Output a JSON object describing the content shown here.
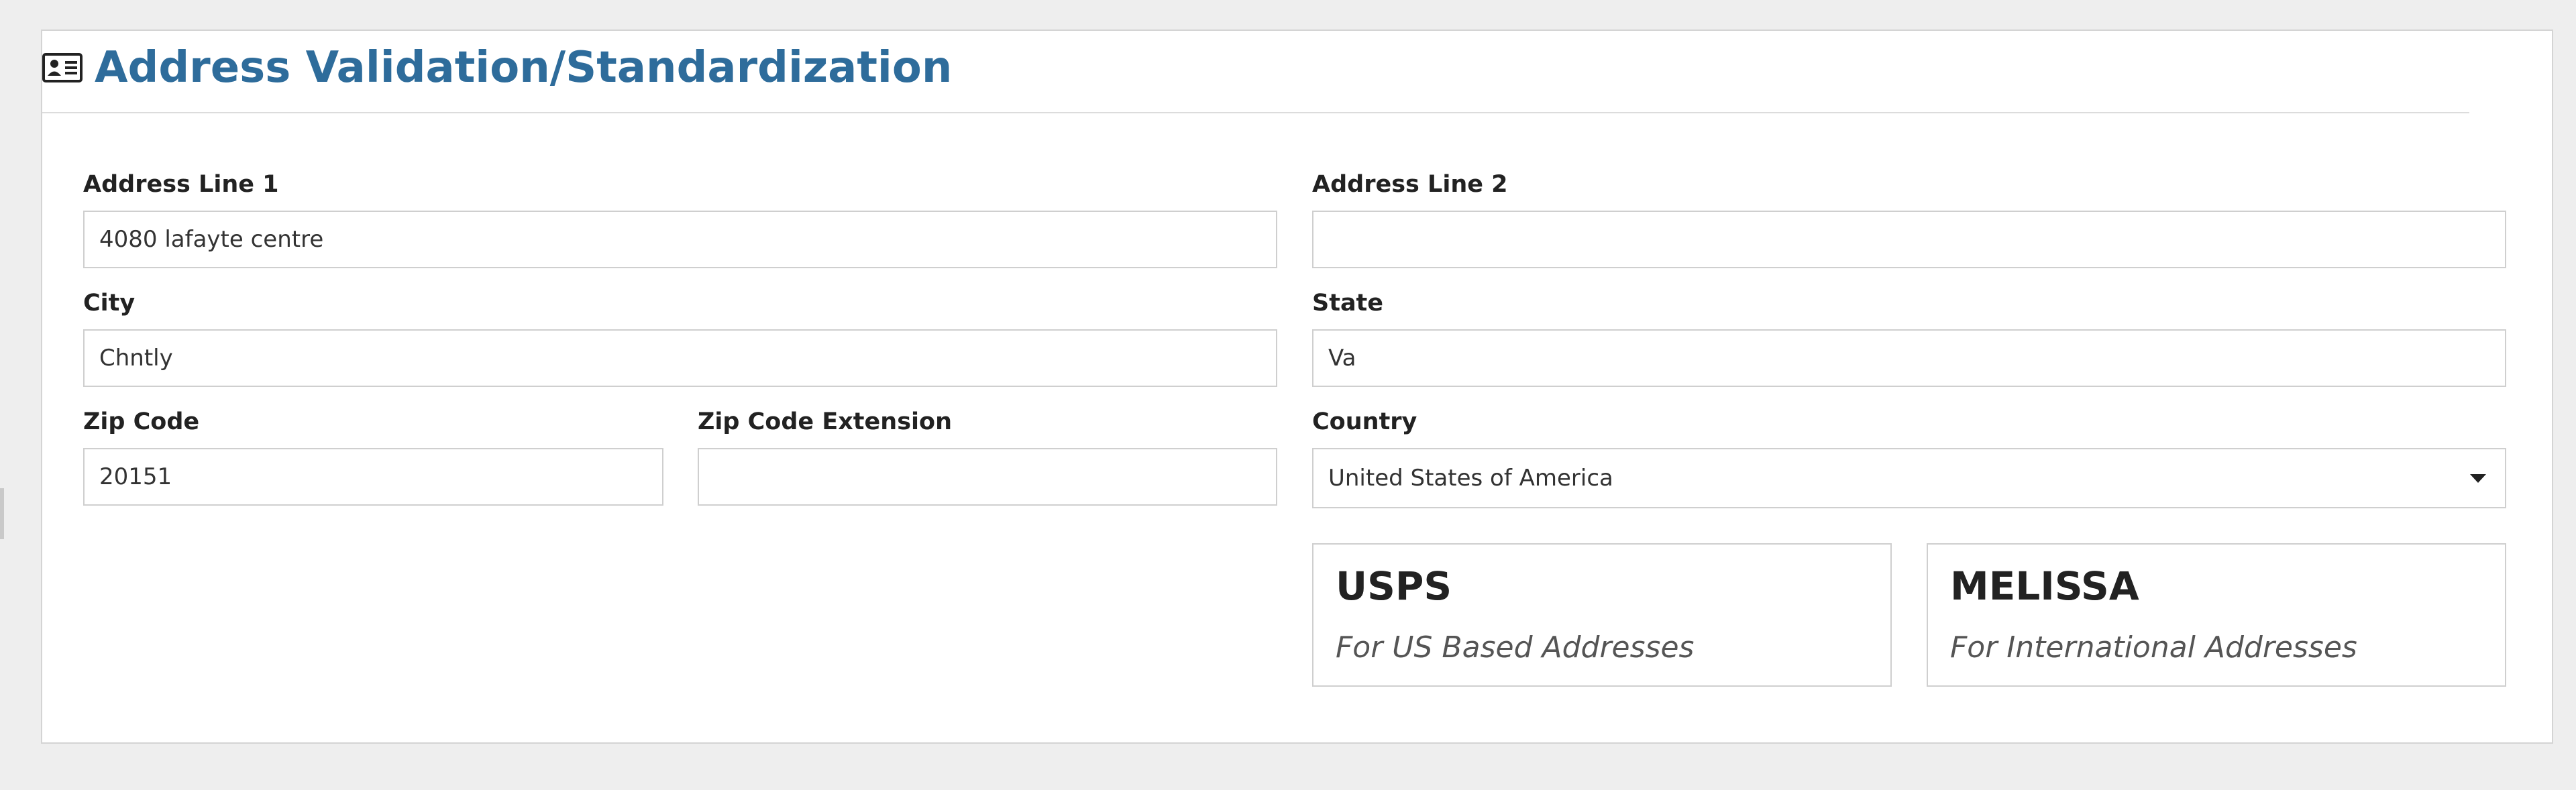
{
  "header": {
    "title": "Address Validation/Standardization",
    "icon": "address-card-icon"
  },
  "form": {
    "address_line1": {
      "label": "Address Line 1",
      "value": "4080 lafayte centre"
    },
    "address_line2": {
      "label": "Address Line 2",
      "value": ""
    },
    "city": {
      "label": "City",
      "value": "Chntly"
    },
    "state": {
      "label": "State",
      "value": "Va"
    },
    "zip": {
      "label": "Zip Code",
      "value": "20151"
    },
    "zip_ext": {
      "label": "Zip Code Extension",
      "value": ""
    },
    "country": {
      "label": "Country",
      "value": "United States of America",
      "icon": "chevron-down-icon"
    }
  },
  "services": [
    {
      "name": "USPS",
      "description": "For US Based Addresses"
    },
    {
      "name": "MELISSA",
      "description": "For International Addresses"
    }
  ],
  "colors": {
    "accent": "#2e6c9b",
    "background": "#eeeeee",
    "panel": "#ffffff",
    "border": "#cfcfcf"
  }
}
